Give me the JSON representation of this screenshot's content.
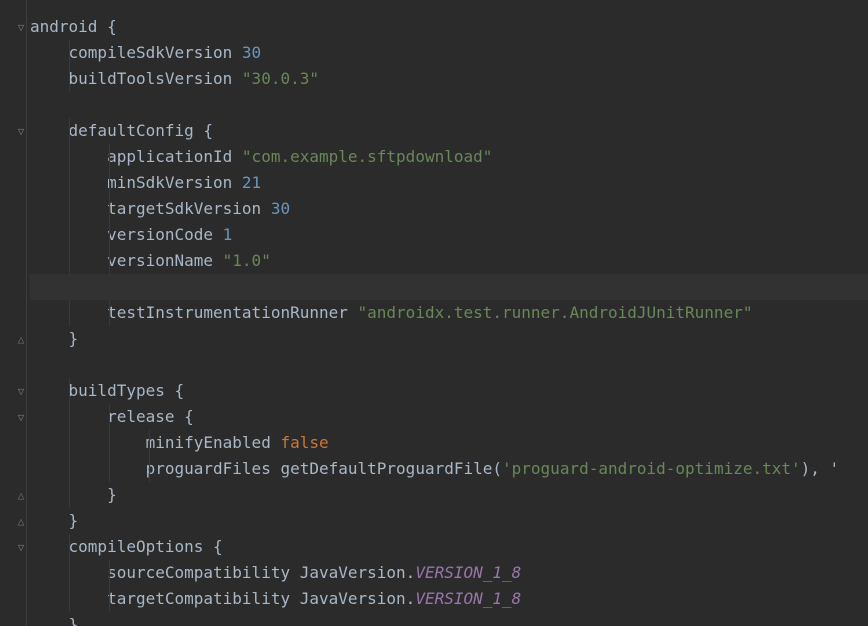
{
  "lines": [
    {
      "text": "android {"
    },
    {
      "text": "    compileSdkVersion ",
      "value": "30",
      "vtype": "num"
    },
    {
      "text": "    buildToolsVersion ",
      "value": "\"30.0.3\"",
      "vtype": "str"
    },
    {
      "text": ""
    },
    {
      "text": "    defaultConfig {"
    },
    {
      "text": "        applicationId ",
      "value": "\"com.example.sftpdownload\"",
      "vtype": "str"
    },
    {
      "text": "        minSdkVersion ",
      "value": "21",
      "vtype": "num"
    },
    {
      "text": "        targetSdkVersion ",
      "value": "30",
      "vtype": "num"
    },
    {
      "text": "        versionCode ",
      "value": "1",
      "vtype": "num"
    },
    {
      "text": "        versionName ",
      "value": "\"1.0\"",
      "vtype": "str"
    },
    {
      "text": "",
      "current": true
    },
    {
      "text": "        testInstrumentationRunner ",
      "value": "\"androidx.test.runner.AndroidJUnitRunner\"",
      "vtype": "str"
    },
    {
      "text": "    }"
    },
    {
      "text": ""
    },
    {
      "text": "    buildTypes {"
    },
    {
      "text": "        release {"
    },
    {
      "text": "            minifyEnabled ",
      "value": "false",
      "vtype": "kw"
    },
    {
      "text": "            proguardFiles getDefaultProguardFile(",
      "value": "'proguard-android-optimize.txt'",
      "vtype": "str",
      "after": "), '"
    },
    {
      "text": "        }"
    },
    {
      "text": "    }"
    },
    {
      "text": "    compileOptions {"
    },
    {
      "text": "        sourceCompatibility JavaVersion.",
      "value": "VERSION_1_8",
      "vtype": "const"
    },
    {
      "text": "        targetCompatibility JavaVersion.",
      "value": "VERSION_1_8",
      "vtype": "const"
    },
    {
      "text": "    }"
    }
  ],
  "fold_markers": [
    {
      "line": 0,
      "glyph": "▽"
    },
    {
      "line": 4,
      "glyph": "▽"
    },
    {
      "line": 12,
      "glyph": "△"
    },
    {
      "line": 14,
      "glyph": "▽"
    },
    {
      "line": 15,
      "glyph": "▽"
    },
    {
      "line": 18,
      "glyph": "△"
    },
    {
      "line": 19,
      "glyph": "△"
    },
    {
      "line": 20,
      "glyph": "▽"
    }
  ],
  "colors": {
    "background": "#2b2b2b",
    "text": "#a9b7c6",
    "number": "#6897bb",
    "string": "#6a8759",
    "keyword": "#cc7832",
    "constant": "#9876aa",
    "current_line": "#323232"
  }
}
